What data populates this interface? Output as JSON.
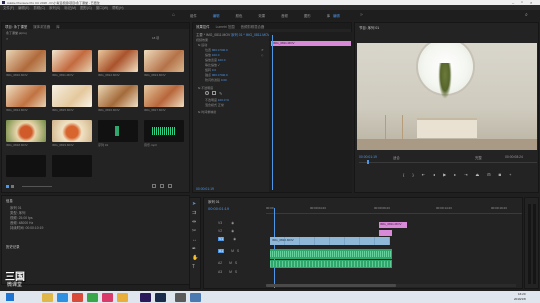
{
  "app": {
    "title": "Adobe Premiere Pro CC 2018 - D:\\小青豆视频\\项目\\永丁课堂 - 已更改",
    "menu": [
      "文件(F)",
      "编辑(E)",
      "剪辑(C)",
      "序列(S)",
      "标记(M)",
      "图形(G)",
      "窗口(W)",
      "帮助(H)"
    ],
    "workspaces": [
      "组件",
      "编辑",
      "颜色",
      "效果",
      "音频",
      "图形",
      "库"
    ],
    "workspace_active": "编辑"
  },
  "project": {
    "tabs": [
      "项目: 永丁课堂",
      "媒体浏览器",
      "库"
    ],
    "path": "永丁课堂.prproj",
    "count": "18 项",
    "items": [
      {
        "name": "IMG_0810.MOV",
        "dur": "10:21"
      },
      {
        "name": "IMG_0811.MOV",
        "dur": "12:04"
      },
      {
        "name": "IMG_0812.MOV",
        "dur": "8:15"
      },
      {
        "name": "IMG_0813.MOV",
        "dur": "9:02"
      },
      {
        "name": "IMG_0814.MOV",
        "dur": "6:11"
      },
      {
        "name": "IMG_0815.MOV",
        "dur": "5:20"
      },
      {
        "name": "IMG_0816.MOV",
        "dur": "7:08"
      },
      {
        "name": "IMG_0817.MOV",
        "dur": "4:13"
      },
      {
        "name": "IMG_0818.MOV",
        "dur": "11:05"
      },
      {
        "name": "IMG_0819.MOV",
        "dur": "3:22"
      },
      {
        "name": "序列 01",
        "dur": "1:25:12"
      },
      {
        "name": "音乐.mp3",
        "dur": "3:45"
      }
    ]
  },
  "info": {
    "title": "信息",
    "lines": [
      "序列 01",
      "类型: 序列",
      "视频: 25.00 fps",
      "音频: 48000 Hz",
      "持续时间: 00:00:10:19"
    ],
    "history_title": "历史记录"
  },
  "effect_controls": {
    "tabs": [
      "效果控件",
      "Lumetri 范围",
      "音频剪辑混合器"
    ],
    "source": "主要 * IMG_0811.MOV",
    "clip": "序列 01 * IMG_0811.MOV",
    "sections": [
      {
        "label": "视频效果",
        "kind": "header"
      },
      {
        "label": "运动",
        "kind": "fx"
      },
      {
        "label": "位置",
        "value": "960.0  540.0"
      },
      {
        "label": "缩放",
        "value": "100.0"
      },
      {
        "label": "缩放宽度",
        "value": "100.0"
      },
      {
        "label": "等比缩放",
        "value": "✓"
      },
      {
        "label": "旋转",
        "value": "0.0"
      },
      {
        "label": "锚点",
        "value": "960.0  540.0"
      },
      {
        "label": "防闪烁滤镜",
        "value": "0.00"
      },
      {
        "label": "不透明度",
        "kind": "fx"
      },
      {
        "label": "不透明度",
        "value": "100.0 %"
      },
      {
        "label": "混合模式",
        "value": "正常"
      },
      {
        "label": "时间重映射",
        "kind": "fx"
      }
    ],
    "timecode": "00:00:01:19",
    "mini_clip": "IMG_0811.MOV"
  },
  "program": {
    "title": "节目: 序列 01",
    "timecode": "00:00:01:19",
    "fit": "适合",
    "quality": "完整",
    "duration": "00:00:08:24"
  },
  "timeline": {
    "title": "序列 01",
    "timecode": "00:00:01:19",
    "ruler": [
      "00:00",
      "00:00:04:23",
      "00:00:09:23",
      "00:00:14:23",
      "00:00:19:23"
    ],
    "tracks_video": [
      "V3",
      "V2",
      "V1"
    ],
    "tracks_audio": [
      "A1",
      "A2",
      "A3"
    ],
    "clip_pink_label": "IMG_0811.MOV",
    "clip_blue_label": "IMG_0810.MOV"
  },
  "taskbar": {
    "time": "16:20",
    "date": "2019/1/8",
    "logo_line1": "三国",
    "logo_line2": "微课堂"
  },
  "colors": {
    "accent_blue": "#4d97e6",
    "clip_pink": "#d88ad9",
    "clip_blue": "#8fb7d8",
    "audio_green": "#2fa66b",
    "taskbar": "#dfe6ee"
  }
}
